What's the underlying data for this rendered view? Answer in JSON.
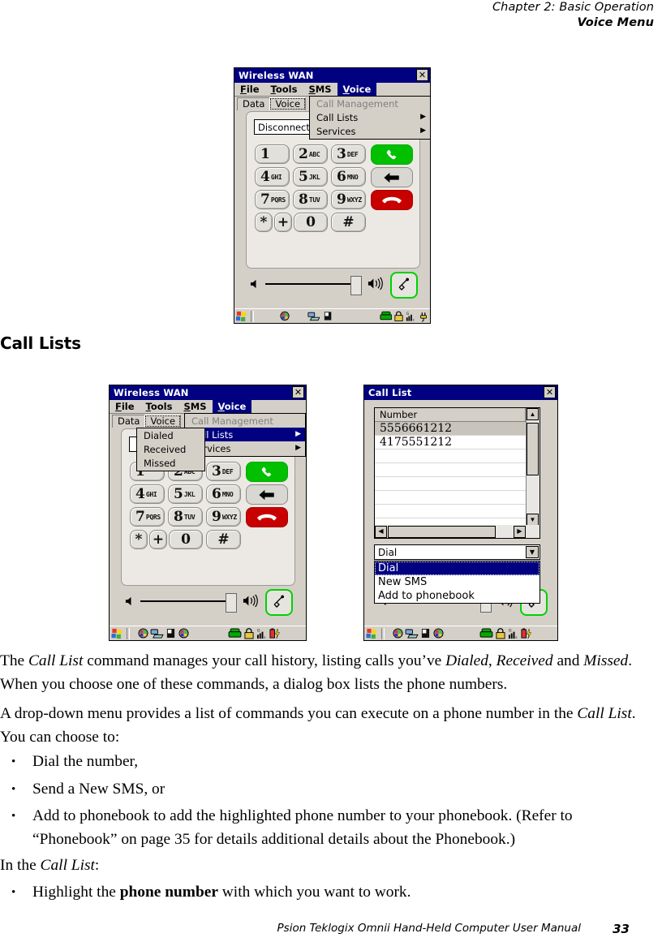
{
  "runhead": {
    "line1": "Chapter 2:  Basic Operation",
    "line2": "Voice Menu"
  },
  "section_heading": "Call Lists",
  "paragraphs": {
    "p1_a": "The ",
    "p1_b": "Call List",
    "p1_c": " command manages your call history, listing calls you’ve ",
    "p1_d": "Dialed",
    "p1_e": ", ",
    "p1_f": "Received",
    "p1_g": " and ",
    "p1_h": "Missed",
    "p1_i": ". When you choose one of these commands, a dialog box lists the phone numbers.",
    "p2_a": "A drop-down menu provides a list of commands you can execute on a phone number in the ",
    "p2_b": "Call List",
    "p2_c": ". You can choose to:",
    "p3_a": "In the ",
    "p3_b": "Call List",
    "p3_c": ":"
  },
  "bullets": {
    "dot": "•",
    "b1": "Dial the number,",
    "b2": "Send a New SMS, or",
    "b3_a": "Add to phonebook to add the highlighted phone number to your phonebook. (Refer to “Phonebook” on page 35 for details additional details about the Phonebook.)",
    "b4_a": "Highlight the ",
    "b4_b": "phone number",
    "b4_c": " with which you want to work."
  },
  "footer": {
    "text": "Psion Teklogix Omnii Hand-Held Computer User Manual",
    "page": "33"
  },
  "window1": {
    "title": "Wireless WAN",
    "close_label": "✕",
    "menubar": [
      {
        "label": "File",
        "mnemonic": "F"
      },
      {
        "label": "Tools",
        "mnemonic": "T"
      },
      {
        "label": "SMS",
        "mnemonic": "S"
      },
      {
        "label": "Voice",
        "mnemonic": "V"
      }
    ],
    "tabs": [
      {
        "label": "Data",
        "selected": false
      },
      {
        "label": "Voice",
        "selected": true
      }
    ],
    "status_field": "Disconnected fr",
    "voice_menu": [
      {
        "label": "Call Management",
        "disabled": true,
        "submenu": false,
        "highlight": false
      },
      {
        "label": "Call Lists",
        "disabled": false,
        "submenu": true,
        "highlight": false
      },
      {
        "label": "Services",
        "disabled": false,
        "submenu": true,
        "highlight": false
      }
    ],
    "keypad": [
      {
        "digit": "1",
        "letters": ""
      },
      {
        "digit": "2",
        "letters": "ABC"
      },
      {
        "digit": "3",
        "letters": "DEF"
      },
      {
        "digit": "4",
        "letters": "GHI"
      },
      {
        "digit": "5",
        "letters": "JKL"
      },
      {
        "digit": "6",
        "letters": "MNO"
      },
      {
        "digit": "7",
        "letters": "PQRS"
      },
      {
        "digit": "8",
        "letters": "TUV"
      },
      {
        "digit": "9",
        "letters": "WXYZ"
      },
      {
        "digit": "*",
        "letters": ""
      },
      {
        "digit": "+",
        "letters": ""
      },
      {
        "digit": "0",
        "letters": ""
      },
      {
        "digit": "#",
        "letters": ""
      }
    ],
    "action_keys": {
      "send": "call-send",
      "back": "backspace",
      "end": "call-end"
    },
    "taskbar_icons": [
      "start-icon",
      "network-icon",
      "desktop-icon",
      "pda-icon",
      "phone-icon",
      "lock-icon",
      "signal-icon",
      "power-icon"
    ]
  },
  "window2": {
    "title": "Wireless WAN",
    "close_label": "✕",
    "menubar": [
      {
        "label": "File",
        "mnemonic": "F"
      },
      {
        "label": "Tools",
        "mnemonic": "T"
      },
      {
        "label": "SMS",
        "mnemonic": "S"
      },
      {
        "label": "Voice",
        "mnemonic": "V"
      }
    ],
    "tabs": [
      {
        "label": "Data",
        "selected": false
      },
      {
        "label": "Voice",
        "selected": true
      }
    ],
    "voice_menu": [
      {
        "label": "Call Management",
        "disabled": true,
        "submenu": false,
        "highlight": false
      },
      {
        "label": "Call Lists",
        "disabled": false,
        "submenu": true,
        "highlight": true
      },
      {
        "label": "Services",
        "disabled": false,
        "submenu": true,
        "highlight": false
      }
    ],
    "call_lists_submenu": [
      {
        "label": "Dialed",
        "mnemonic": "D"
      },
      {
        "label": "Received",
        "mnemonic": "R"
      },
      {
        "label": "Missed",
        "mnemonic": "M"
      }
    ],
    "taskbar_icons": [
      "start-icon",
      "network-icon",
      "desktop-icon",
      "pda-icon",
      "network2-icon",
      "phone-icon",
      "lock-icon",
      "signal-icon",
      "battery-icon"
    ]
  },
  "window3": {
    "title": "Call List",
    "close_label": "✕",
    "list_header": "Number",
    "rows": [
      {
        "number": "5556661212",
        "selected": true
      },
      {
        "number": "4175551212",
        "selected": false
      },
      {
        "number": "",
        "selected": false
      },
      {
        "number": "",
        "selected": false
      },
      {
        "number": "",
        "selected": false
      },
      {
        "number": "",
        "selected": false
      },
      {
        "number": "",
        "selected": false
      },
      {
        "number": "",
        "selected": false
      }
    ],
    "combo_value": "Dial",
    "combo_options": [
      {
        "label": "Dial",
        "selected": true
      },
      {
        "label": "New SMS",
        "selected": false
      },
      {
        "label": "Add to phonebook",
        "selected": false
      }
    ],
    "scroll_up": "▲",
    "scroll_down": "▼",
    "scroll_left": "◀",
    "scroll_right": "▶",
    "combo_arrow": "▼",
    "taskbar_icons": [
      "start-icon",
      "network-icon",
      "desktop-icon",
      "pda-icon",
      "network2-icon",
      "phone-icon",
      "lock-icon",
      "signal-icon",
      "battery-icon"
    ]
  },
  "colors": {
    "titlebar": "#000080",
    "chrome": "#d4d0c8",
    "highlight": "#000080",
    "send_key": "#00c000",
    "end_key": "#c80000",
    "mic_border": "#00d200"
  }
}
